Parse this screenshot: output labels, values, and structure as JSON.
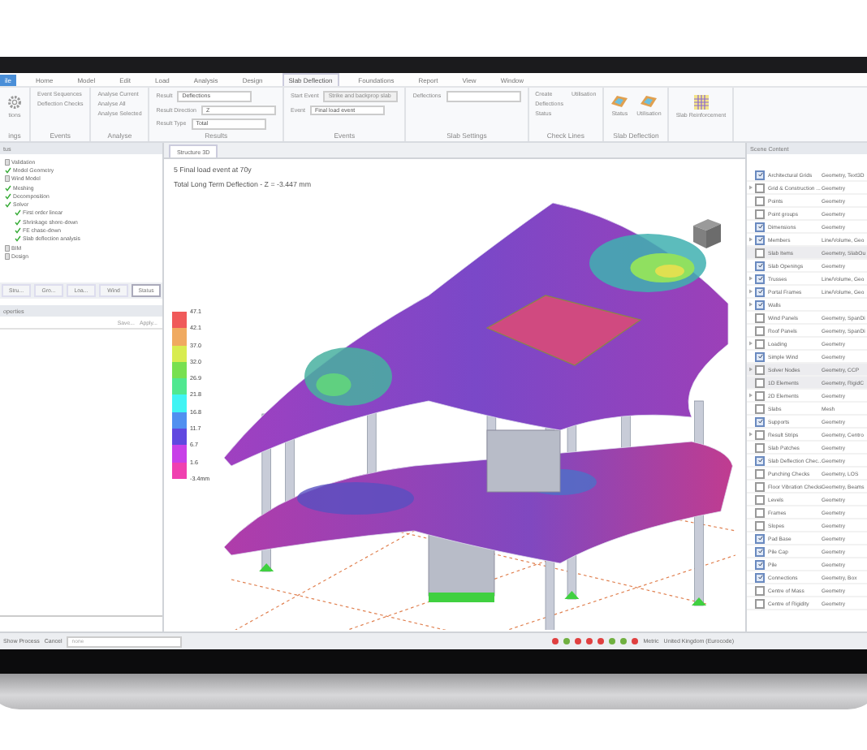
{
  "menu_tabs": [
    {
      "label": "ile",
      "selected": false
    },
    {
      "label": "Home",
      "selected": false
    },
    {
      "label": "Model",
      "selected": false
    },
    {
      "label": "Edit",
      "selected": false
    },
    {
      "label": "Load",
      "selected": false
    },
    {
      "label": "Analysis",
      "selected": false
    },
    {
      "label": "Design",
      "selected": false
    },
    {
      "label": "Slab Deflection",
      "selected": true
    },
    {
      "label": "Foundations",
      "selected": false
    },
    {
      "label": "Report",
      "selected": false
    },
    {
      "label": "View",
      "selected": false
    },
    {
      "label": "Window",
      "selected": false
    }
  ],
  "ribbon_groups": [
    {
      "label": "ings",
      "items": [
        {
          "kind": "big",
          "label": "tions"
        }
      ]
    },
    {
      "label": "Events",
      "items": [
        {
          "kind": "small",
          "label": "Event Sequences"
        },
        {
          "kind": "small",
          "label": "Deflection Checks"
        }
      ]
    },
    {
      "label": "Analyse",
      "items": [
        {
          "kind": "small",
          "label": "Analyse Current"
        },
        {
          "kind": "small",
          "label": "Analyse All"
        },
        {
          "kind": "small",
          "label": "Analyse Selected"
        }
      ]
    },
    {
      "label": "Results",
      "items": [
        {
          "kind": "combo",
          "label": "Result",
          "value": "Deflections",
          "disabled": false
        },
        {
          "kind": "combo",
          "label": "Result Direction",
          "value": "Z",
          "disabled": false
        },
        {
          "kind": "combo",
          "label": "Result Type",
          "value": "Total",
          "disabled": false
        }
      ]
    },
    {
      "label": "Events",
      "items": [
        {
          "kind": "combo",
          "label": "Start Event",
          "value": "Strike and backprop slab",
          "disabled": true
        },
        {
          "kind": "combo",
          "label": "Event",
          "value": "Final load event",
          "disabled": false
        }
      ]
    },
    {
      "label": "Slab Settings",
      "items": [
        {
          "kind": "combo",
          "label": "Deflections",
          "value": "",
          "disabled": false
        }
      ]
    },
    {
      "label": "Check Lines",
      "items": [
        {
          "kind": "small",
          "label": "Create"
        },
        {
          "kind": "small",
          "label": "Deflections"
        },
        {
          "kind": "small",
          "label": "Status"
        },
        {
          "kind": "small",
          "label": "Utilisation"
        }
      ]
    },
    {
      "label": "Slab Deflection",
      "items": [
        {
          "kind": "big",
          "label": "Status"
        },
        {
          "kind": "big",
          "label": "Utilisation"
        }
      ]
    },
    {
      "items": [
        {
          "kind": "big",
          "label": "Slab Reinforcement"
        }
      ]
    }
  ],
  "process_panel": {
    "title": "tus",
    "tree": [
      {
        "label": "Validation",
        "done": false
      },
      {
        "label": "Model Geometry",
        "done": true
      },
      {
        "label": "Wind Model",
        "done": false
      },
      {
        "label": "Meshing",
        "done": true
      },
      {
        "label": "Decomposition",
        "done": true
      },
      {
        "label": "Solver",
        "done": true,
        "children": [
          {
            "label": "First order linear",
            "done": true
          },
          {
            "label": "Shrinkage shore-down",
            "done": true
          },
          {
            "label": "FE chase-down",
            "done": true
          },
          {
            "label": "Slab deflection analysis",
            "done": true
          }
        ]
      },
      {
        "label": "BIM",
        "done": false
      },
      {
        "label": "Design",
        "done": false
      }
    ],
    "tabs": [
      {
        "label": "Stru...",
        "selected": false
      },
      {
        "label": "Gro...",
        "selected": false
      },
      {
        "label": "Loa...",
        "selected": false
      },
      {
        "label": "Wind",
        "selected": false
      },
      {
        "label": "Status",
        "selected": true
      }
    ]
  },
  "properties_panel": {
    "title": "operties",
    "actions": [
      "Save...",
      "Apply..."
    ]
  },
  "document": {
    "tab": "Structure 3D",
    "lines": [
      "5 Final load event at 70y",
      "Total Long Term Deflection - Z = -3.447 mm"
    ],
    "legend": {
      "labels": [
        "47.1",
        "42.1",
        "37.0",
        "32.0",
        "26.9",
        "21.8",
        "16.8",
        "11.7",
        "6.7",
        "1.6",
        "-3.4mm"
      ],
      "bands": [
        {
          "color": "#f05a5a"
        },
        {
          "color": "#f0aa60"
        },
        {
          "color": "#d8ec50"
        },
        {
          "color": "#78e050"
        },
        {
          "color": "#50e890"
        },
        {
          "color": "#40f4f4"
        },
        {
          "color": "#5090f0"
        },
        {
          "color": "#6048e0"
        },
        {
          "color": "#c840e8"
        },
        {
          "color": "#f040b0"
        }
      ]
    }
  },
  "scene_content": {
    "title": "Scene Content",
    "rows": [
      {
        "name": "Architectural Grids",
        "type": "Geometry, Text3D",
        "checked": true,
        "expandable": false,
        "selected": false
      },
      {
        "name": "Grid & Construction ...",
        "type": "Geometry",
        "checked": false,
        "expandable": true,
        "selected": false
      },
      {
        "name": "Points",
        "type": "Geometry",
        "checked": false,
        "expandable": false,
        "selected": false
      },
      {
        "name": "Point groups",
        "type": "Geometry",
        "checked": false,
        "expandable": false,
        "selected": false
      },
      {
        "name": "Dimensions",
        "type": "Geometry",
        "checked": true,
        "expandable": false,
        "selected": false
      },
      {
        "name": "Members",
        "type": "Line/Volume, Geo",
        "checked": true,
        "expandable": true,
        "selected": false
      },
      {
        "name": "Slab Items",
        "type": "Geometry, SlabOu",
        "checked": false,
        "expandable": false,
        "selected": true
      },
      {
        "name": "Slab Openings",
        "type": "Geometry",
        "checked": true,
        "expandable": false,
        "selected": false
      },
      {
        "name": "Trusses",
        "type": "Line/Volume, Geo",
        "checked": true,
        "expandable": true,
        "selected": false
      },
      {
        "name": "Portal Frames",
        "type": "Line/Volume, Geo",
        "checked": true,
        "expandable": true,
        "selected": false
      },
      {
        "name": "Walls",
        "type": "",
        "checked": true,
        "expandable": true,
        "selected": false
      },
      {
        "name": "Wind Panels",
        "type": "Geometry, SpanDi",
        "checked": false,
        "expandable": false,
        "selected": false
      },
      {
        "name": "Roof Panels",
        "type": "Geometry, SpanDi",
        "checked": false,
        "expandable": false,
        "selected": false
      },
      {
        "name": "Loading",
        "type": "Geometry",
        "checked": false,
        "expandable": true,
        "selected": false
      },
      {
        "name": "Simple Wind",
        "type": "Geometry",
        "checked": true,
        "expandable": false,
        "selected": false
      },
      {
        "name": "Solver Nodes",
        "type": "Geometry, CCP",
        "checked": false,
        "expandable": true,
        "selected": true
      },
      {
        "name": "1D Elements",
        "type": "Geometry, RigidC",
        "checked": false,
        "expandable": false,
        "selected": true
      },
      {
        "name": "2D Elements",
        "type": "Geometry",
        "checked": false,
        "expandable": true,
        "selected": false
      },
      {
        "name": "Slabs",
        "type": "Mesh",
        "checked": false,
        "expandable": false,
        "selected": false
      },
      {
        "name": "Supports",
        "type": "Geometry",
        "checked": true,
        "expandable": false,
        "selected": false
      },
      {
        "name": "Result Strips",
        "type": "Geometry, Centro",
        "checked": false,
        "expandable": true,
        "selected": false
      },
      {
        "name": "Slab Patches",
        "type": "Geometry",
        "checked": false,
        "expandable": false,
        "selected": false
      },
      {
        "name": "Slab Deflection Chec...",
        "type": "Geometry",
        "checked": true,
        "expandable": false,
        "selected": false
      },
      {
        "name": "Punching Checks",
        "type": "Geometry, LOS",
        "checked": false,
        "expandable": false,
        "selected": false
      },
      {
        "name": "Floor Vibration Checks",
        "type": "Geometry, Beams",
        "checked": false,
        "expandable": false,
        "selected": false
      },
      {
        "name": "Levels",
        "type": "Geometry",
        "checked": false,
        "expandable": false,
        "selected": false
      },
      {
        "name": "Frames",
        "type": "Geometry",
        "checked": false,
        "expandable": false,
        "selected": false
      },
      {
        "name": "Slopes",
        "type": "Geometry",
        "checked": false,
        "expandable": false,
        "selected": false
      },
      {
        "name": "Pad Base",
        "type": "Geometry",
        "checked": true,
        "expandable": false,
        "selected": false
      },
      {
        "name": "Pile Cap",
        "type": "Geometry",
        "checked": true,
        "expandable": false,
        "selected": false
      },
      {
        "name": "Pile",
        "type": "Geometry",
        "checked": true,
        "expandable": false,
        "selected": false
      },
      {
        "name": "Connections",
        "type": "Geometry, Box",
        "checked": true,
        "expandable": false,
        "selected": false
      },
      {
        "name": "Centre of Mass",
        "type": "Geometry",
        "checked": false,
        "expandable": false,
        "selected": false
      },
      {
        "name": "Centre of Rigidity",
        "type": "Geometry",
        "checked": false,
        "expandable": false,
        "selected": false
      }
    ]
  },
  "status_bar": {
    "actions": [
      "Show Process",
      "Cancel"
    ],
    "field": {
      "placeholder": "none"
    },
    "indicators": [
      {
        "color": "#e04040"
      },
      {
        "color": "#70b040"
      },
      {
        "color": "#e04040"
      },
      {
        "color": "#e04040"
      },
      {
        "color": "#e04040"
      },
      {
        "color": "#70b040"
      },
      {
        "color": "#70b040"
      },
      {
        "color": "#e04040"
      }
    ],
    "units": "Metric",
    "region": "United Kingdom (Eurocode)"
  }
}
